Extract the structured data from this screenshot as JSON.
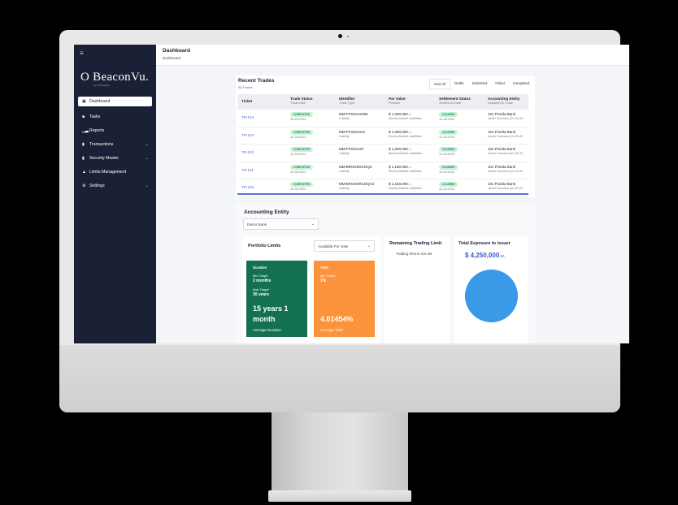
{
  "header": {
    "title": "Dashboard",
    "breadcrumb": "Dashboard"
  },
  "brand": {
    "name": "O BeaconVu.",
    "tagline": "by conTessical"
  },
  "sidebar": {
    "items": [
      {
        "label": "Dashboard",
        "icon": "dashboard-icon",
        "active": true
      },
      {
        "label": "Tasks",
        "icon": "tasks-icon"
      },
      {
        "label": "Reports",
        "icon": "reports-icon"
      },
      {
        "label": "Transactions",
        "icon": "document-icon",
        "expandable": true
      },
      {
        "label": "Security Master",
        "icon": "document-icon",
        "expandable": true
      },
      {
        "label": "Limits Management",
        "icon": "warning-icon"
      },
      {
        "label": "Settings",
        "icon": "gear-icon",
        "expandable": true
      }
    ]
  },
  "trades": {
    "title": "Recent Trades",
    "subtitle": "All Trades",
    "tabs": [
      "View All",
      "Drafts",
      "Submitted",
      "Failed",
      "Completed"
    ],
    "columns": [
      {
        "main": "Ticket",
        "sub": ""
      },
      {
        "main": "Trade Status",
        "sub": "Trade Date"
      },
      {
        "main": "Identifier",
        "sub": "Trade Type"
      },
      {
        "main": "Par Value",
        "sub": "Portfolio"
      },
      {
        "main": "Settlement Status",
        "sub": "Settlement Date"
      },
      {
        "main": "Accounting Entity",
        "sub": "Updated By / Date"
      }
    ],
    "rows": [
      {
        "ticket": "TR-124",
        "status": "COMPLETED",
        "trade_date": "10-28-2024",
        "identifier": "MM:FFSSOLDM2",
        "type": "Liability",
        "par": "$ 1,250,000",
        "par_cents": ".00",
        "portfolio": "Money Market Liabilities",
        "settlement": "CLEARED",
        "settle_date": "10-28-2024",
        "entity": "101 Florida Bank",
        "updated": "Javier Guevara (11-28-20"
      },
      {
        "ticket": "TR-123",
        "status": "COMPLETED",
        "trade_date": "10-28-2024",
        "identifier": "MM:FFSSOLD2",
        "type": "Liability",
        "par": "$ 1,250,000",
        "par_cents": ".00",
        "portfolio": "Money Market Liabilities",
        "settlement": "CLEARED",
        "settle_date": "10-28-2024",
        "entity": "101 Florida Bank",
        "updated": "Javier Guevara (11-28-20"
      },
      {
        "ticket": "TR-122",
        "status": "COMPLETED",
        "trade_date": "10-28-2024",
        "identifier": "MM:FFSSOLM",
        "type": "Liability",
        "par": "$ 1,250,000",
        "par_cents": ".00",
        "portfolio": "Money Market Liabilities",
        "settlement": "CLEARED",
        "settle_date": "10-28-2024",
        "entity": "101 Florida Bank",
        "updated": "Javier Guevara (11-28-20"
      },
      {
        "ticket": "TR-121",
        "status": "COMPLETED",
        "trade_date": "10-30-2024",
        "identifier": "MM:BROKERCDQ3",
        "type": "Liability",
        "par": "$ 1,150,000",
        "par_cents": ".00",
        "portfolio": "Money Market Liabilities",
        "settlement": "CLEARED",
        "settle_date": "10-30-2024",
        "entity": "101 Florida Bank",
        "updated": "Javier Guevara (11-29-20"
      },
      {
        "ticket": "TR-120",
        "status": "COMPLETED",
        "trade_date": "10-30-2024",
        "identifier": "MM:BROKERCDQA2",
        "type": "Liability",
        "par": "$ 1,150,000",
        "par_cents": ".00",
        "portfolio": "Money Market Liabilities",
        "settlement": "CLEARED",
        "settle_date": "10-30-2024",
        "entity": "101 Florida Bank",
        "updated": "Javier Guevara (11-29-20"
      }
    ]
  },
  "accounting": {
    "heading": "Accounting Entity",
    "entity_value": "Demo Bank",
    "portfolio_limits": {
      "title": "Portfolio Limits",
      "filter_value": "Available For Sale",
      "duration": {
        "label": "Duration",
        "min_label": "Min Target",
        "min_value": "2 months",
        "max_label": "Max Target",
        "max_value": "30 years",
        "big_line1": "15 years 1",
        "big_line2": "month",
        "foot": "Average Duration",
        "color": "#13714f"
      },
      "yield": {
        "label": "Yield",
        "min_label": "Min Target",
        "min_value": "1%",
        "big": "4.01454%",
        "foot": "Average Yield",
        "color": "#fb923c"
      }
    },
    "remaining": {
      "title": "Remaining Trading Limit",
      "status": "Trading limit is not set"
    },
    "exposure": {
      "title": "Total Exposure to issuer",
      "value": "$ 4,250,000",
      "cents": ".00",
      "pie_color": "#3b9ae8"
    }
  }
}
